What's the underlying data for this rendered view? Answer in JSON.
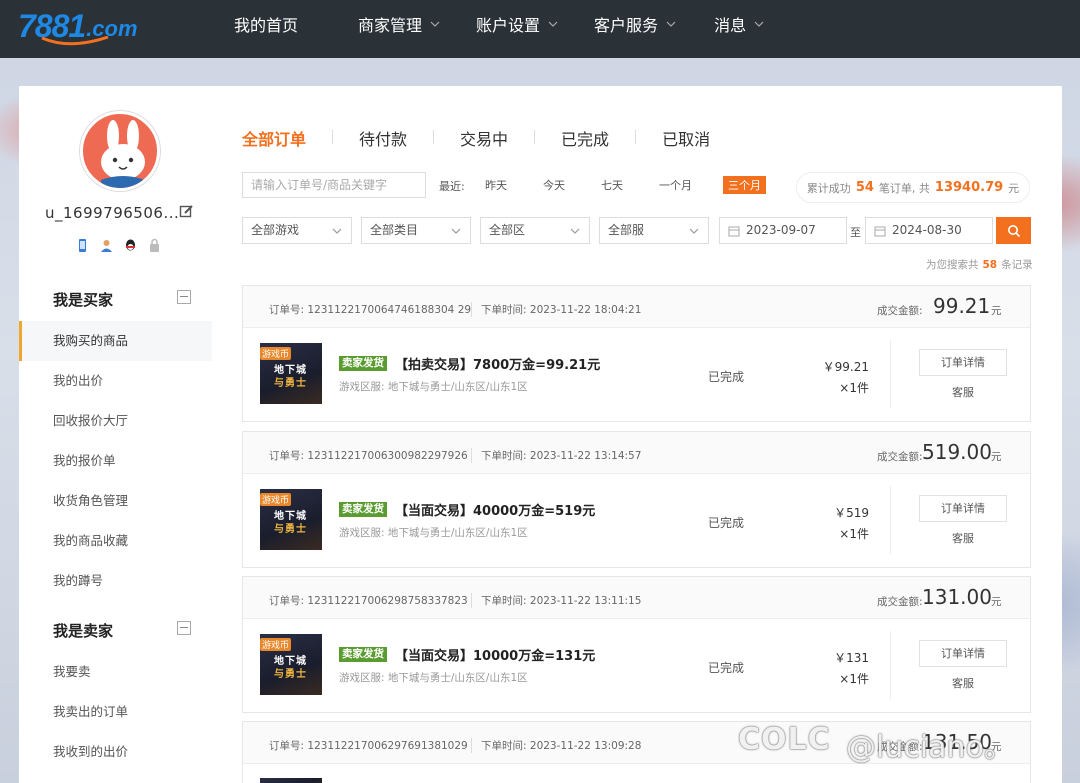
{
  "brand": {
    "logo_number": "7881",
    "logo_suffix": ".com",
    "color": "#1e88e5"
  },
  "nav": {
    "items": [
      {
        "label": "我的首页",
        "has_dropdown": false
      },
      {
        "label": "商家管理",
        "has_dropdown": true
      },
      {
        "label": "账户设置",
        "has_dropdown": true
      },
      {
        "label": "客户服务",
        "has_dropdown": true
      },
      {
        "label": "消息",
        "has_dropdown": true
      }
    ]
  },
  "user": {
    "name": "u_1699796506...",
    "edit_icon": "edit-icon",
    "badges": [
      "phone-icon",
      "person-icon",
      "qq-icon",
      "lock-icon"
    ]
  },
  "sidebar": {
    "buyer": {
      "title": "我是买家",
      "items": [
        "我购买的商品",
        "我的出价",
        "回收报价大厅",
        "我的报价单",
        "收货角色管理",
        "我的商品收藏",
        "我的蹲号"
      ],
      "active_index": 0
    },
    "seller": {
      "title": "我是卖家",
      "items": [
        "我要卖",
        "我卖出的订单",
        "我收到的出价"
      ]
    }
  },
  "tabs": [
    "全部订单",
    "待付款",
    "交易中",
    "已完成",
    "已取消"
  ],
  "active_tab": 0,
  "filters": {
    "search_placeholder": "请输入订单号/商品关键字",
    "recent_label": "最近:",
    "recent_options": [
      "昨天",
      "今天",
      "七天",
      "一个月",
      "三个月"
    ],
    "recent_active": 4,
    "selects": [
      "全部游戏",
      "全部类目",
      "全部区",
      "全部服"
    ],
    "date_from": "2023-09-07",
    "date_to_sep": "至",
    "date_to": "2024-08-30"
  },
  "summary": {
    "prefix": "累计成功",
    "count": "54",
    "mid": "笔订单, 共",
    "amount": "13940.79",
    "unit": "元"
  },
  "results": {
    "prefix": "为您搜索共",
    "count": "58",
    "suffix": "条记录"
  },
  "orders": [
    {
      "order_no_label": "订单号:",
      "order_no": "1231122170064746188304 29",
      "time_label": "下单时间:",
      "time": "2023-11-22 18:04:21",
      "amount_label": "成交金额:",
      "amount": "99.21",
      "yuan": "元",
      "thumb_tag": "游戏币",
      "thumb_line1": "地下城",
      "thumb_line2": "与勇士",
      "seller_tag": "卖家发货",
      "title": "【拍卖交易】7800万金=99.21元",
      "server": "游戏区服: 地下城与勇士/山东区/山东1区",
      "status": "已完成",
      "price": "￥99.21",
      "qty": "×1件",
      "detail_btn": "订单详情",
      "service": "客服"
    },
    {
      "order_no_label": "订单号:",
      "order_no": "123112217006300982297926",
      "time_label": "下单时间:",
      "time": "2023-11-22 13:14:57",
      "amount_label": "成交金额:",
      "amount": "519.00",
      "yuan": "元",
      "thumb_tag": "游戏币",
      "thumb_line1": "地下城",
      "thumb_line2": "与勇士",
      "seller_tag": "卖家发货",
      "title": "【当面交易】40000万金=519元",
      "server": "游戏区服: 地下城与勇士/山东区/山东1区",
      "status": "已完成",
      "price": "￥519",
      "qty": "×1件",
      "detail_btn": "订单详情",
      "service": "客服"
    },
    {
      "order_no_label": "订单号:",
      "order_no": "123112217006298758337823",
      "time_label": "下单时间:",
      "time": "2023-11-22 13:11:15",
      "amount_label": "成交金额:",
      "amount": "131.00",
      "yuan": "元",
      "thumb_tag": "游戏币",
      "thumb_line1": "地下城",
      "thumb_line2": "与勇士",
      "seller_tag": "卖家发货",
      "title": "【当面交易】10000万金=131元",
      "server": "游戏区服: 地下城与勇士/山东区/山东1区",
      "status": "已完成",
      "price": "￥131",
      "qty": "×1件",
      "detail_btn": "订单详情",
      "service": "客服"
    },
    {
      "order_no_label": "订单号:",
      "order_no": "123112217006297691381029",
      "time_label": "下单时间:",
      "time": "2023-11-22 13:09:28",
      "amount_label": "成交金额:",
      "amount": "131.50",
      "yuan": "元"
    }
  ],
  "watermark": {
    "left": "COLC",
    "right": "@luciano。"
  },
  "colors": {
    "accent": "#f3701f",
    "nav_bg": "#2a3137",
    "seller_tag": "#5a9c2f",
    "active_marker": "#f0a82b"
  }
}
